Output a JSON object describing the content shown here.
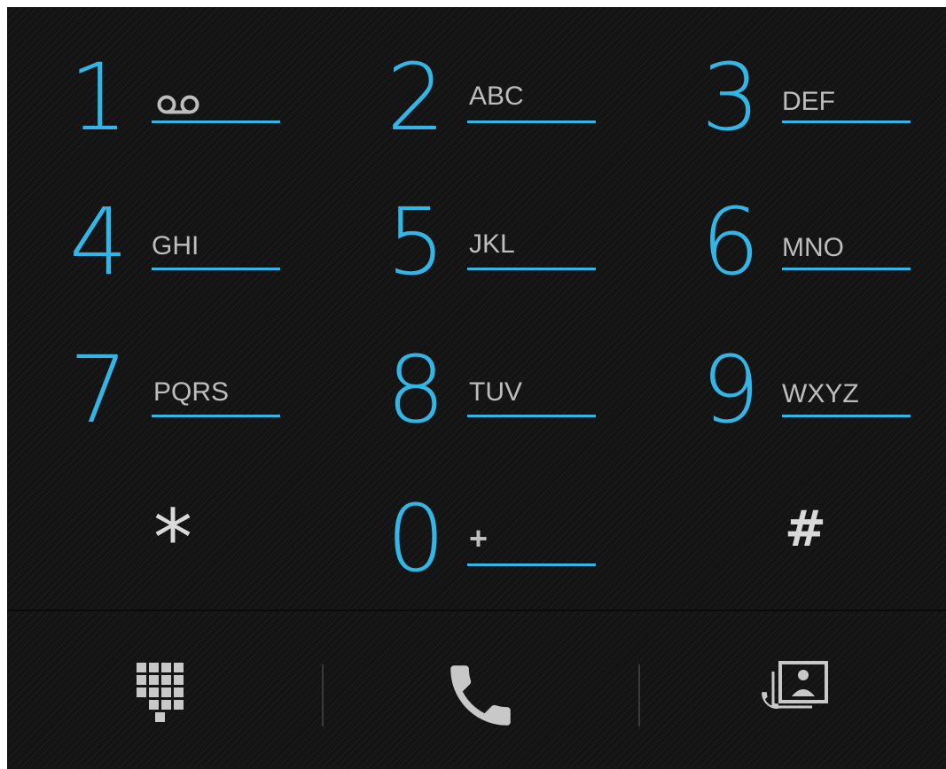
{
  "colors": {
    "accent": "#33b5e5",
    "letters": "#bdbdbd",
    "symbol": "#d9d9d9",
    "icon": "#c8c8c8",
    "background": "#141414"
  },
  "keys": [
    {
      "digit": "1",
      "letters": "",
      "icon": "voicemail-icon"
    },
    {
      "digit": "2",
      "letters": "ABC"
    },
    {
      "digit": "3",
      "letters": "DEF"
    },
    {
      "digit": "4",
      "letters": "GHI"
    },
    {
      "digit": "5",
      "letters": "JKL"
    },
    {
      "digit": "6",
      "letters": "MNO"
    },
    {
      "digit": "7",
      "letters": "PQRS"
    },
    {
      "digit": "8",
      "letters": "TUV"
    },
    {
      "digit": "9",
      "letters": "WXYZ"
    },
    {
      "digit": "*",
      "letters": ""
    },
    {
      "digit": "0",
      "letters": "+"
    },
    {
      "digit": "#",
      "letters": ""
    }
  ],
  "bottom_bar": {
    "buttons": [
      {
        "name": "dialpad-toggle",
        "icon": "dialpad-icon"
      },
      {
        "name": "call",
        "icon": "phone-icon"
      },
      {
        "name": "contacts",
        "icon": "contacts-icon"
      }
    ]
  }
}
